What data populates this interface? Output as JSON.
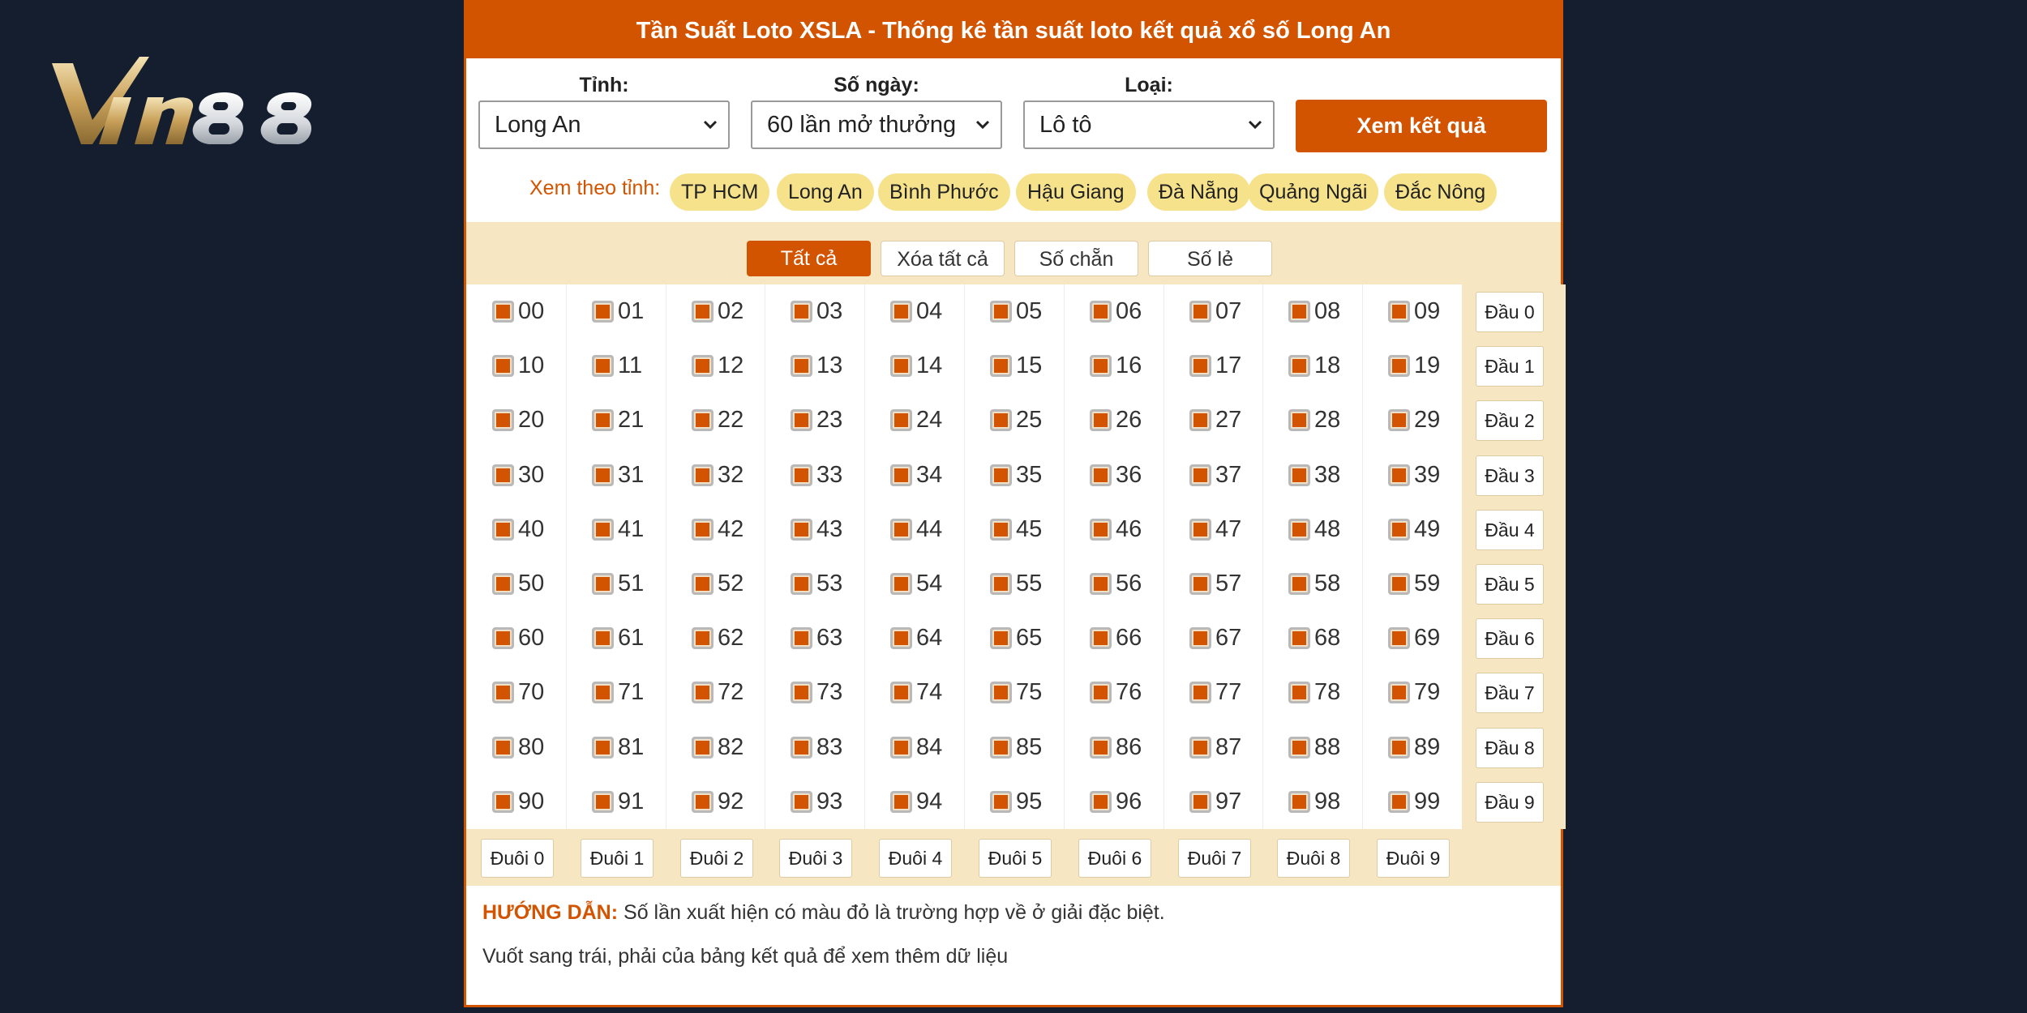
{
  "brand": {
    "logo_text": "Vin88"
  },
  "header": {
    "title": "Tần Suất Loto XSLA - Thống kê tần suất loto kết quả xổ số Long An"
  },
  "filters": {
    "province_label": "Tỉnh:",
    "province_value": "Long An",
    "days_label": "Số ngày:",
    "days_value": "60 lần mở thưởng",
    "type_label": "Loại:",
    "type_value": "Lô tô",
    "submit_label": "Xem kết quả"
  },
  "provinces": {
    "prefix": "Xem theo tỉnh:",
    "items": [
      "TP HCM",
      "Long An",
      "Bình Phước",
      "Hậu Giang",
      "Đà Nẵng",
      "Quảng Ngãi",
      "Đắc Nông"
    ]
  },
  "tabs": [
    "Tất cả",
    "Xóa tất cả",
    "Số chẵn",
    "Số lẻ"
  ],
  "numbers": [
    "00",
    "01",
    "02",
    "03",
    "04",
    "05",
    "06",
    "07",
    "08",
    "09",
    "10",
    "11",
    "12",
    "13",
    "14",
    "15",
    "16",
    "17",
    "18",
    "19",
    "20",
    "21",
    "22",
    "23",
    "24",
    "25",
    "26",
    "27",
    "28",
    "29",
    "30",
    "31",
    "32",
    "33",
    "34",
    "35",
    "36",
    "37",
    "38",
    "39",
    "40",
    "41",
    "42",
    "43",
    "44",
    "45",
    "46",
    "47",
    "48",
    "49",
    "50",
    "51",
    "52",
    "53",
    "54",
    "55",
    "56",
    "57",
    "58",
    "59",
    "60",
    "61",
    "62",
    "63",
    "64",
    "65",
    "66",
    "67",
    "68",
    "69",
    "70",
    "71",
    "72",
    "73",
    "74",
    "75",
    "76",
    "77",
    "78",
    "79",
    "80",
    "81",
    "82",
    "83",
    "84",
    "85",
    "86",
    "87",
    "88",
    "89",
    "90",
    "91",
    "92",
    "93",
    "94",
    "95",
    "96",
    "97",
    "98",
    "99"
  ],
  "all_checked": true,
  "dau_buttons": [
    "Đầu 0",
    "Đầu 1",
    "Đầu 2",
    "Đầu 3",
    "Đầu 4",
    "Đầu 5",
    "Đầu 6",
    "Đầu 7",
    "Đầu 8",
    "Đầu 9"
  ],
  "duoi_buttons": [
    "Đuôi 0",
    "Đuôi 1",
    "Đuôi 2",
    "Đuôi 3",
    "Đuôi 4",
    "Đuôi 5",
    "Đuôi 6",
    "Đuôi 7",
    "Đuôi 8",
    "Đuôi 9"
  ],
  "guide": {
    "title": "HƯỚNG DẪN:",
    "text": "Số lần xuất hiện có màu đỏ là trường hợp về ở giải đặc biệt.",
    "swipe": "Vuốt sang trái, phải của bảng kết quả để xem thêm dữ liệu"
  },
  "colors": {
    "accent": "#d35400",
    "chip": "#f7e28c",
    "beige": "#f6e6c1",
    "background": "#141e2e"
  }
}
